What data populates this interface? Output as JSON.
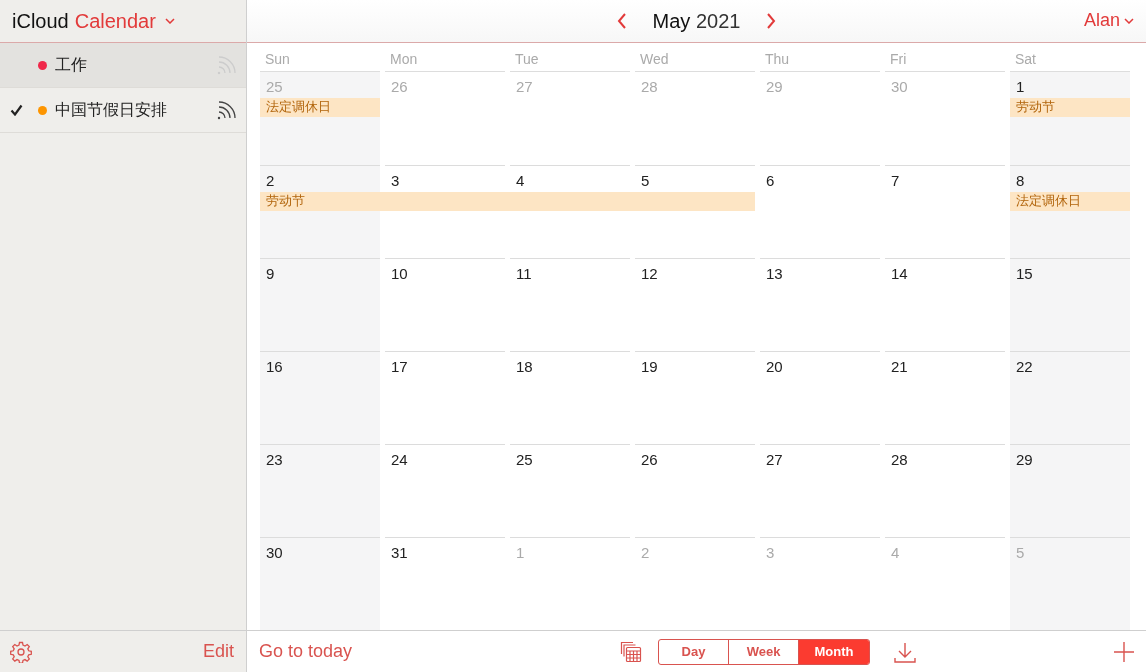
{
  "app_title": {
    "brand": "iCloud",
    "name": "Calendar"
  },
  "calendars": [
    {
      "name": "工作",
      "color": "#f0284a",
      "checked": false,
      "selected": true
    },
    {
      "name": "中国节假日安排",
      "color": "#fd9500",
      "checked": true,
      "selected": false
    }
  ],
  "sidebar_footer": {
    "edit": "Edit"
  },
  "header": {
    "month_title": "**May** 2021",
    "user": "Alan"
  },
  "weekdays": [
    "Sun",
    "Mon",
    "Tue",
    "Wed",
    "Thu",
    "Fri",
    "Sat"
  ],
  "weeks": [
    {
      "days": [
        {
          "n": "25",
          "muted": true,
          "event": "法定调休日"
        },
        {
          "n": "26",
          "muted": true
        },
        {
          "n": "27",
          "muted": true
        },
        {
          "n": "28",
          "muted": true
        },
        {
          "n": "29",
          "muted": true
        },
        {
          "n": "30",
          "muted": true
        },
        {
          "n": "1",
          "muted": false,
          "event": "劳动节"
        }
      ]
    },
    {
      "days": [
        {
          "n": "2",
          "muted": false,
          "event": "劳动节"
        },
        {
          "n": "3",
          "muted": false,
          "event_continued": true
        },
        {
          "n": "4",
          "muted": false,
          "event_continued": true
        },
        {
          "n": "5",
          "muted": false,
          "event_continued": true
        },
        {
          "n": "6",
          "muted": false
        },
        {
          "n": "7",
          "muted": false
        },
        {
          "n": "8",
          "muted": false,
          "event": "法定调休日"
        }
      ]
    },
    {
      "days": [
        {
          "n": "9",
          "muted": false
        },
        {
          "n": "10",
          "muted": false
        },
        {
          "n": "11",
          "muted": false
        },
        {
          "n": "12",
          "muted": false
        },
        {
          "n": "13",
          "muted": false
        },
        {
          "n": "14",
          "muted": false
        },
        {
          "n": "15",
          "muted": false
        }
      ]
    },
    {
      "days": [
        {
          "n": "16",
          "muted": false
        },
        {
          "n": "17",
          "muted": false
        },
        {
          "n": "18",
          "muted": false
        },
        {
          "n": "19",
          "muted": false
        },
        {
          "n": "20",
          "muted": false
        },
        {
          "n": "21",
          "muted": false
        },
        {
          "n": "22",
          "muted": false
        }
      ]
    },
    {
      "days": [
        {
          "n": "23",
          "muted": false
        },
        {
          "n": "24",
          "muted": false
        },
        {
          "n": "25",
          "muted": false
        },
        {
          "n": "26",
          "muted": false
        },
        {
          "n": "27",
          "muted": false
        },
        {
          "n": "28",
          "muted": false
        },
        {
          "n": "29",
          "muted": false
        }
      ]
    },
    {
      "days": [
        {
          "n": "30",
          "muted": false
        },
        {
          "n": "31",
          "muted": false
        },
        {
          "n": "1",
          "muted": true
        },
        {
          "n": "2",
          "muted": true
        },
        {
          "n": "3",
          "muted": true
        },
        {
          "n": "4",
          "muted": true
        },
        {
          "n": "5",
          "muted": true
        }
      ]
    }
  ],
  "footer": {
    "today": "Go to today",
    "views": [
      {
        "label": "Day",
        "selected": false
      },
      {
        "label": "Week",
        "selected": false
      },
      {
        "label": "Month",
        "selected": true
      }
    ]
  }
}
